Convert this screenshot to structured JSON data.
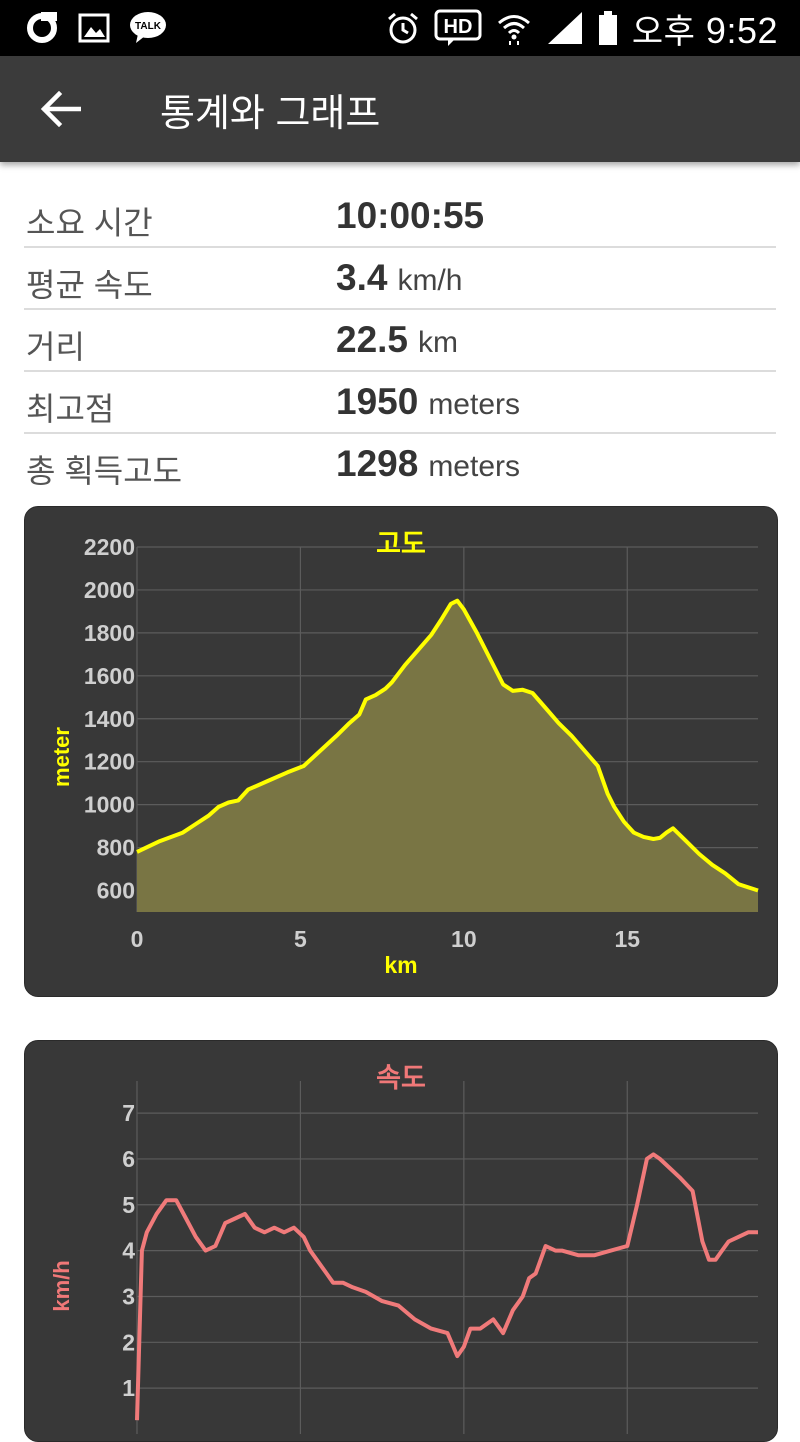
{
  "status_bar": {
    "time_period": "오후",
    "time": "9:52",
    "left_icons": [
      "olleh-o-icon",
      "gallery-image-icon",
      "kakaotalk-icon"
    ],
    "right_icons": [
      "alarm-clock-icon",
      "hd-voice-icon",
      "wifi-icon",
      "signal-bars-icon",
      "battery-icon"
    ],
    "kakao_badge_text": "TALK",
    "hd_text": "HD"
  },
  "app_bar": {
    "title": "통계와 그래프",
    "background": "#3b3b3b"
  },
  "stats": [
    {
      "label": "소요 시간",
      "value": "10:00:55",
      "unit": ""
    },
    {
      "label": "평균 속도",
      "value": "3.4",
      "unit": "km/h"
    },
    {
      "label": "거리",
      "value": "22.5",
      "unit": "km"
    },
    {
      "label": "최고점",
      "value": "1950",
      "unit": "meters"
    },
    {
      "label": "총 획득고도",
      "value": "1298",
      "unit": "meters"
    }
  ],
  "elevation_chart": {
    "title": "고도",
    "ylabel": "meter",
    "xlabel": "km",
    "title_color": "#ffff00",
    "line_color": "#ffff00",
    "fill_color": "#797544"
  },
  "speed_chart": {
    "title": "속도",
    "ylabel": "km/h",
    "title_color": "#f07878",
    "line_color": "#f07a7a"
  },
  "chart_data": [
    {
      "type": "area",
      "title": "고도",
      "xlabel": "km",
      "ylabel": "meter",
      "xlim": [
        0,
        19
      ],
      "ylim": [
        500,
        2200
      ],
      "x_ticks": [
        0,
        5,
        10,
        15
      ],
      "y_ticks": [
        600,
        800,
        1000,
        1200,
        1400,
        1600,
        1800,
        2000,
        2200
      ],
      "grid": true,
      "x": [
        0,
        0.7,
        1.4,
        1.8,
        2.2,
        2.5,
        2.8,
        3.1,
        3.4,
        4.0,
        4.6,
        5.1,
        5.6,
        6.1,
        6.5,
        6.8,
        7.0,
        7.3,
        7.6,
        7.8,
        8.2,
        8.6,
        9.0,
        9.3,
        9.6,
        9.8,
        10.0,
        10.4,
        10.8,
        11.2,
        11.5,
        11.8,
        12.1,
        12.5,
        12.9,
        13.3,
        13.7,
        14.1,
        14.4,
        14.6,
        14.9,
        15.2,
        15.5,
        15.8,
        16.0,
        16.2,
        16.4,
        16.8,
        17.2,
        17.6,
        18.0,
        18.4,
        18.8,
        19.0
      ],
      "y": [
        780,
        830,
        870,
        910,
        950,
        990,
        1010,
        1020,
        1070,
        1110,
        1150,
        1180,
        1250,
        1320,
        1380,
        1420,
        1490,
        1510,
        1540,
        1570,
        1650,
        1720,
        1790,
        1860,
        1935,
        1950,
        1910,
        1800,
        1680,
        1560,
        1530,
        1535,
        1520,
        1450,
        1380,
        1320,
        1250,
        1180,
        1050,
        990,
        920,
        870,
        850,
        840,
        845,
        870,
        890,
        830,
        770,
        720,
        680,
        630,
        610,
        600
      ]
    },
    {
      "type": "line",
      "title": "속도",
      "ylabel": "km/h",
      "xlim": [
        0,
        19
      ],
      "ylim": [
        0,
        7.7
      ],
      "y_ticks": [
        1,
        2,
        3,
        4,
        5,
        6,
        7
      ],
      "grid": true,
      "x": [
        0,
        0.15,
        0.3,
        0.6,
        0.9,
        1.2,
        1.5,
        1.8,
        2.1,
        2.4,
        2.7,
        3.0,
        3.3,
        3.6,
        3.9,
        4.2,
        4.5,
        4.8,
        5.1,
        5.3,
        5.5,
        5.8,
        6.0,
        6.3,
        6.6,
        7.0,
        7.5,
        8.0,
        8.5,
        9.0,
        9.5,
        9.8,
        10.0,
        10.2,
        10.5,
        10.9,
        11.2,
        11.5,
        11.8,
        12.0,
        12.2,
        12.5,
        12.8,
        13.0,
        13.5,
        14.0,
        14.5,
        15.0,
        15.3,
        15.6,
        15.8,
        16.0,
        16.3,
        16.6,
        17.0,
        17.3,
        17.5,
        17.7,
        17.9,
        18.1,
        18.4,
        18.7,
        19.0
      ],
      "y": [
        0.3,
        4.0,
        4.4,
        4.8,
        5.1,
        5.1,
        4.7,
        4.3,
        4.0,
        4.1,
        4.6,
        4.7,
        4.8,
        4.5,
        4.4,
        4.5,
        4.4,
        4.5,
        4.3,
        4.0,
        3.8,
        3.5,
        3.3,
        3.3,
        3.2,
        3.1,
        2.9,
        2.8,
        2.5,
        2.3,
        2.2,
        1.7,
        1.9,
        2.3,
        2.3,
        2.5,
        2.2,
        2.7,
        3.0,
        3.4,
        3.5,
        4.1,
        4.0,
        4.0,
        3.9,
        3.9,
        4.0,
        4.1,
        5.0,
        6.0,
        6.1,
        6.0,
        5.8,
        5.6,
        5.3,
        4.2,
        3.8,
        3.8,
        4.0,
        4.2,
        4.3,
        4.4,
        4.4
      ]
    }
  ]
}
